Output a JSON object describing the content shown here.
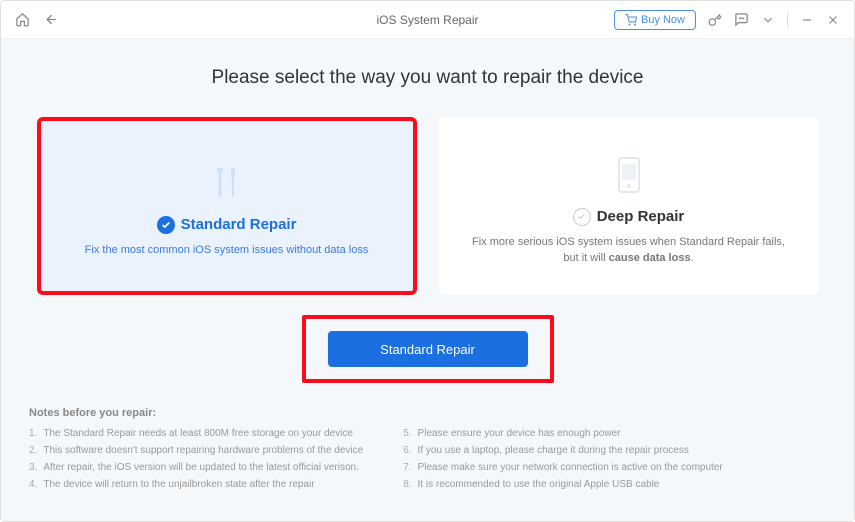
{
  "titlebar": {
    "title": "iOS System Repair",
    "buy_now": "Buy Now"
  },
  "heading": "Please select the way you want to repair the device",
  "cards": {
    "standard": {
      "title": "Standard Repair",
      "desc": "Fix the most common iOS system issues without data loss"
    },
    "deep": {
      "title": "Deep Repair",
      "desc_pre": "Fix more serious iOS system issues when Standard Repair fails, but it will ",
      "desc_bold": "cause data loss",
      "desc_post": "."
    }
  },
  "action_button": "Standard Repair",
  "notes": {
    "title": "Notes before you repair:",
    "left": [
      "The Standard Repair needs at least 800M free storage on your device",
      "This software doesn't support repairing hardware problems of the device",
      "After repair, the iOS version will be updated to the latest official verison.",
      "The device will return to the unjailbroken state after the repair"
    ],
    "right": [
      "Please ensure your device has enough power",
      "If you use a laptop, please charge it during the repair process",
      "Please make sure your network connection is active on the computer",
      "It is recommended to use the original Apple USB cable"
    ]
  }
}
